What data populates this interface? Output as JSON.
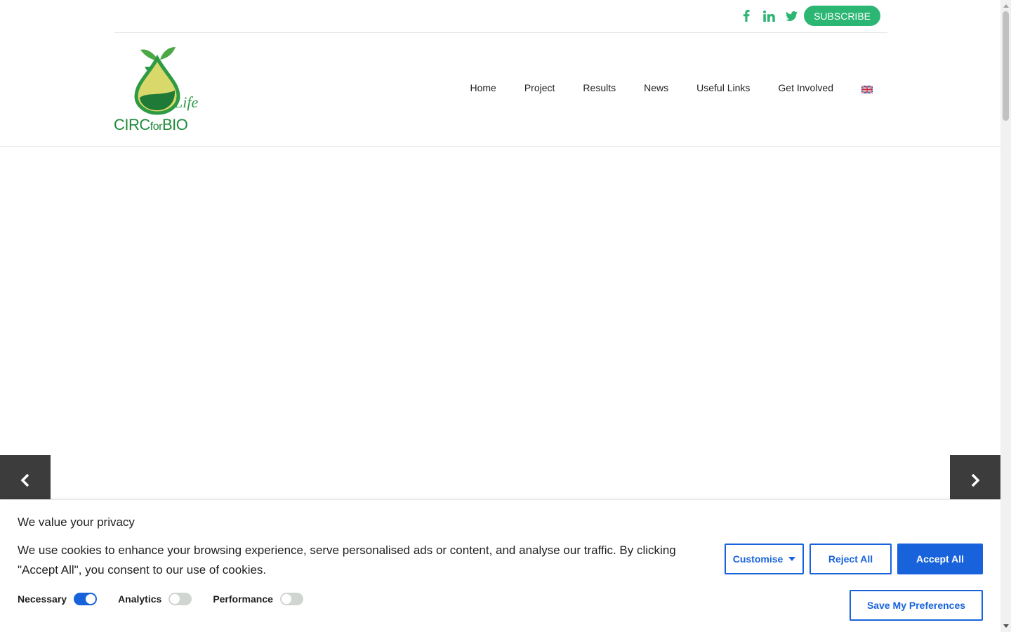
{
  "topbar": {
    "social": [
      {
        "icon": "facebook-icon"
      },
      {
        "icon": "linkedin-icon"
      },
      {
        "icon": "twitter-icon"
      }
    ],
    "subscribe_label": "SUBSCRIBE"
  },
  "header": {
    "logo": {
      "main": "CIRC",
      "mid": "for",
      "end": "BIO",
      "script": "Life"
    },
    "nav": [
      "Home",
      "Project",
      "Results",
      "News",
      "Useful Links",
      "Get Involved"
    ],
    "language_icon": "uk-flag-icon"
  },
  "slider": {
    "prev_icon": "chevron-left-icon",
    "next_icon": "chevron-right-icon"
  },
  "cookie": {
    "title": "We value your privacy",
    "description": "We use cookies to enhance your browsing experience, serve personalised ads or content, and analyse our traffic. By clicking \"Accept All\", you consent to our use of cookies.",
    "toggles": [
      {
        "label": "Necessary",
        "on": true
      },
      {
        "label": "Analytics",
        "on": false
      },
      {
        "label": "Performance",
        "on": false
      }
    ],
    "customise_label": "Customise",
    "reject_label": "Reject All",
    "accept_label": "Accept All",
    "save_label": "Save My Preferences"
  },
  "colors": {
    "brand_green": "#2bb673",
    "cookie_blue": "#1863dc"
  }
}
